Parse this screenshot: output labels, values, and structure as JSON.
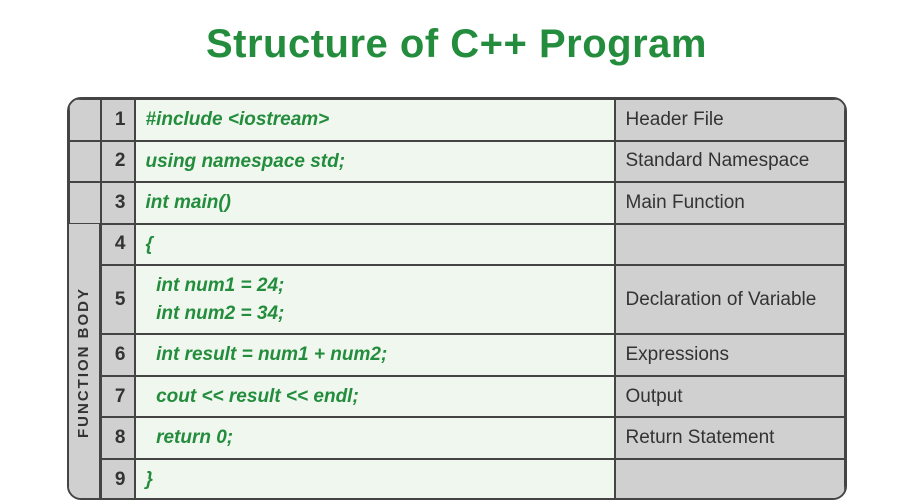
{
  "title": "Structure of C++ Program",
  "side_label": "FUNCTION BODY",
  "rows_top": [
    {
      "n": "1",
      "code": "#include <iostream>",
      "desc": "Header File"
    },
    {
      "n": "2",
      "code": "using namespace std;",
      "desc": "Standard Namespace"
    },
    {
      "n": "3",
      "code": "int main()",
      "desc": "Main Function"
    }
  ],
  "rows_bot": [
    {
      "n": "4",
      "code": "{",
      "desc": ""
    },
    {
      "n": "5",
      "code": "  int num1 = 24;\n  int num2 = 34;",
      "desc": "Declaration of Variable",
      "tall": true
    },
    {
      "n": "6",
      "code": "  int result = num1 + num2;",
      "desc": "Expressions"
    },
    {
      "n": "7",
      "code": "  cout << result << endl;",
      "desc": "Output"
    },
    {
      "n": "8",
      "code": "  return 0;",
      "desc": "Return Statement"
    },
    {
      "n": "9",
      "code": "}",
      "desc": ""
    }
  ]
}
